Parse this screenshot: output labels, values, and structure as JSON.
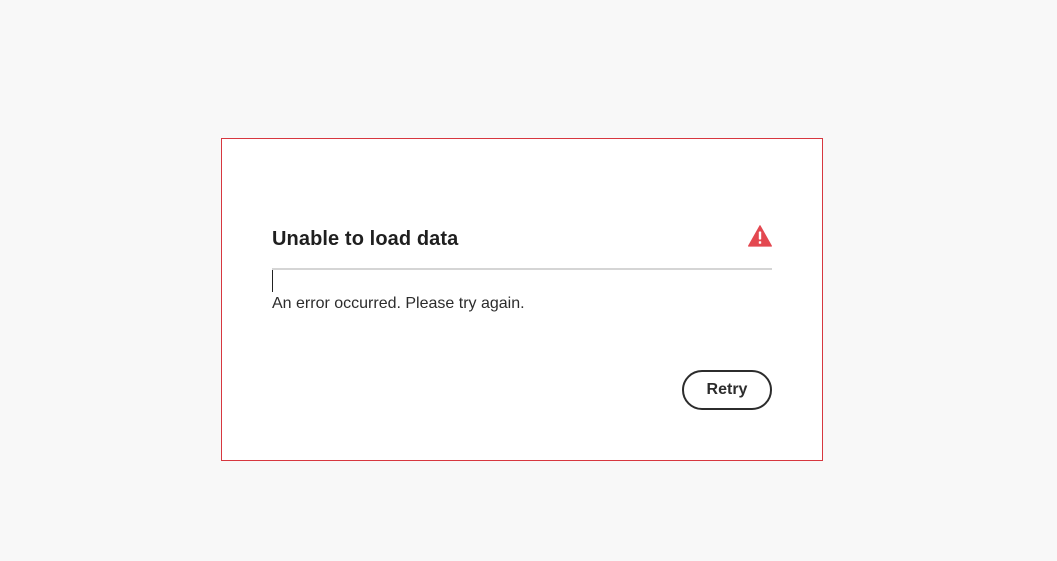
{
  "dialog": {
    "title": "Unable to load data",
    "message": "An error occurred. Please try again.",
    "retry_label": "Retry",
    "icon": "warning-icon"
  },
  "colors": {
    "page_background": "#f8f8f8",
    "dialog_border": "#d7373f",
    "warning": "#e34850",
    "text": "#2c2c2c"
  }
}
